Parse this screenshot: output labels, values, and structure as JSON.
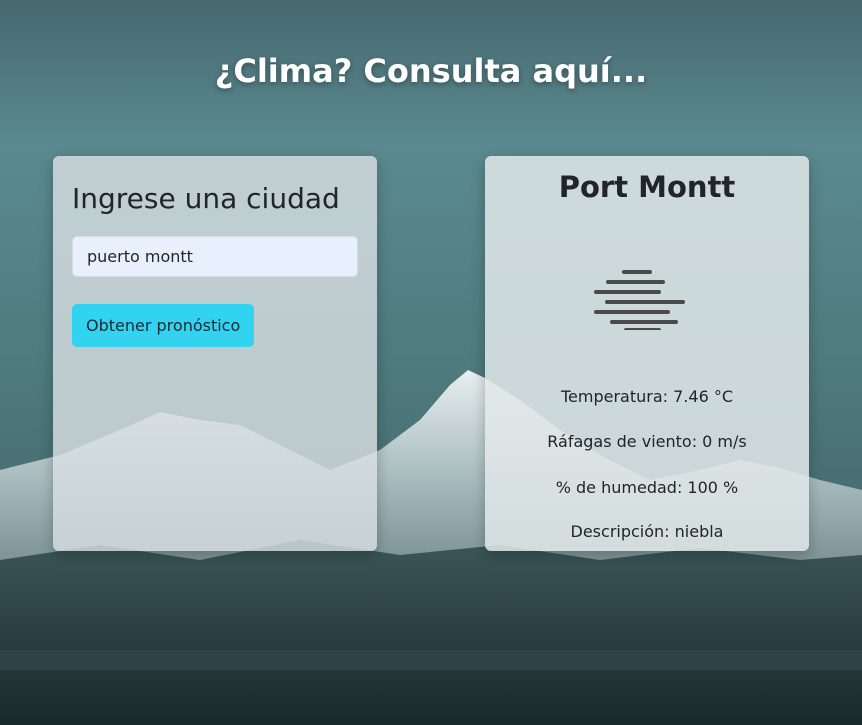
{
  "header": {
    "title": "¿Clima? Consulta aquí..."
  },
  "search": {
    "heading": "Ingrese una ciudad",
    "value": "puerto montt",
    "button_label": "Obtener pronóstico"
  },
  "result": {
    "city": "Port Montt",
    "icon": "fog-icon",
    "temperature": "Temperatura: 7.46 °C",
    "wind": "Ráfagas de viento: 0 m/s",
    "humidity": "% de humedad: 100 %",
    "description": "Descripción: niebla"
  },
  "colors": {
    "button": "#32d2f1",
    "input_bg": "#e8f0fe",
    "card_bg": "#d7dee0"
  }
}
